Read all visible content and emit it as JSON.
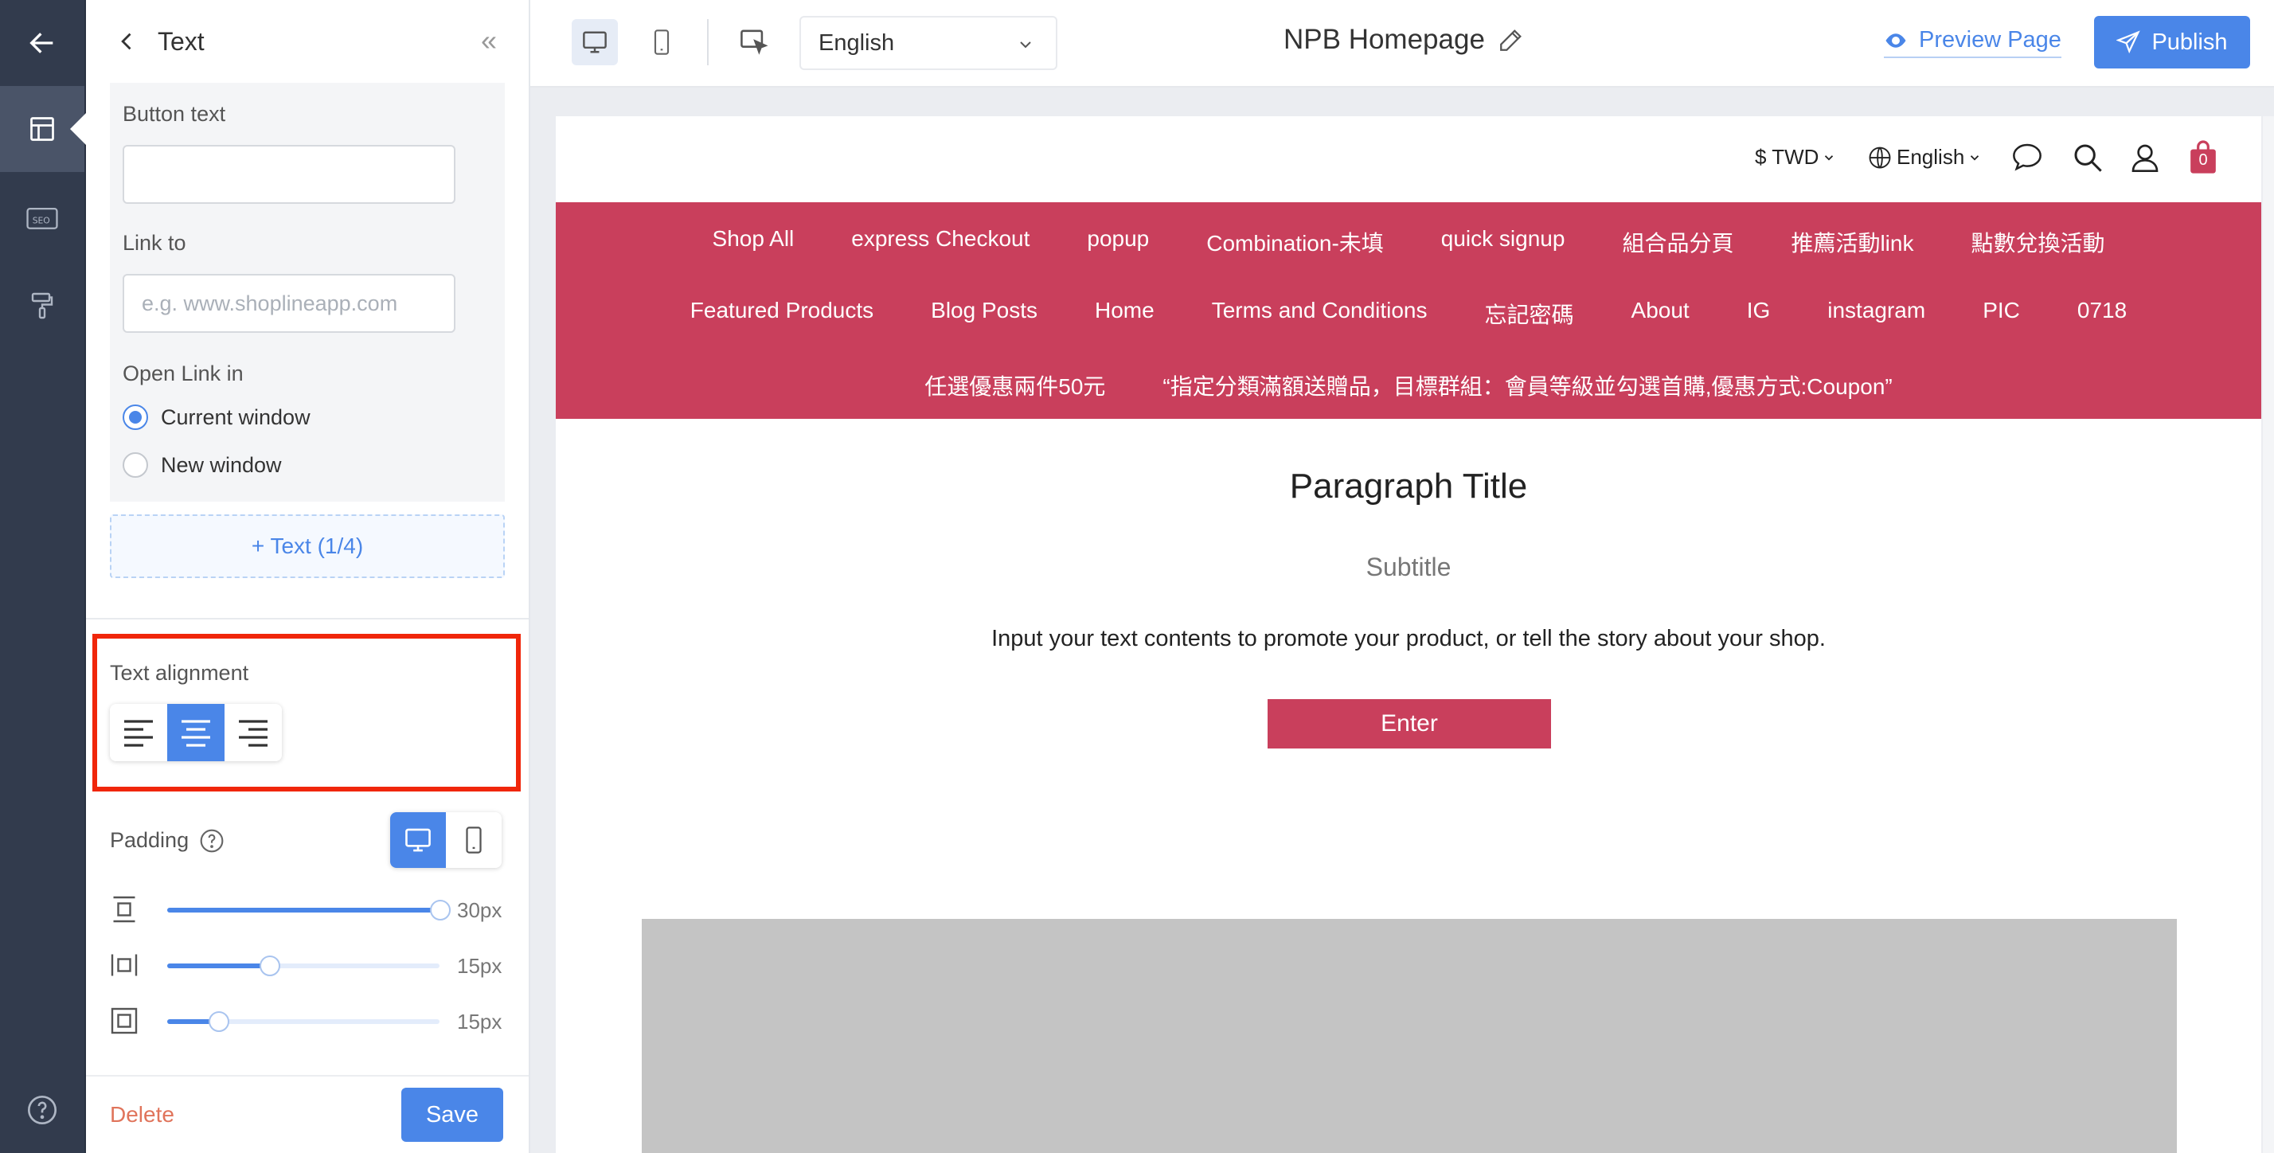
{
  "editor": {
    "panel_title": "Text",
    "button_text_label": "Button text",
    "button_text_value": "",
    "link_to_label": "Link to",
    "link_placeholder": "e.g. www.shoplineapp.com",
    "open_link_label": "Open Link in",
    "open_link_options": [
      "Current window",
      "New window"
    ],
    "open_link_selected": "Current window",
    "add_text_label": "+ Text (1/4)",
    "text_alignment_label": "Text alignment",
    "text_alignment_selected": "center",
    "padding_label": "Padding",
    "padding_device": "desktop",
    "paddings": [
      {
        "name": "vertical",
        "value": "30px",
        "level": 1.0
      },
      {
        "name": "horizontal",
        "value": "15px",
        "level": 0.375
      },
      {
        "name": "all",
        "value": "15px",
        "level": 0.19
      }
    ],
    "delete_label": "Delete",
    "save_label": "Save"
  },
  "toolbar": {
    "language": "English",
    "page_title": "NPB Homepage",
    "preview_label": "Preview Page",
    "publish_label": "Publish"
  },
  "storefront": {
    "currency": "$ TWD",
    "language": "English",
    "cart_count": "0",
    "nav_rows": [
      [
        "Shop All",
        "express Checkout",
        "popup",
        "Combination-未填",
        "quick signup",
        "組合品分頁",
        "推薦活動link",
        "點數兌換活動"
      ],
      [
        "Featured Products",
        "Blog Posts",
        "Home",
        "Terms and Conditions",
        "忘記密碼",
        "About",
        "IG",
        "instagram",
        "PIC",
        "0718"
      ],
      [
        "任選優惠兩件50元",
        "“指定分類滿額送贈品，目標群組：會員等級並勾選首購,優惠方式:Coupon”"
      ]
    ],
    "paragraph_title": "Paragraph Title",
    "subtitle": "Subtitle",
    "body": "Input your text contents to promote your product, or tell the story about your shop.",
    "button_label": "Enter"
  },
  "colors": {
    "accent": "#4a86e8",
    "brand": "#c93f5c",
    "highlight": "#f0260a",
    "rail": "#323b4d"
  }
}
